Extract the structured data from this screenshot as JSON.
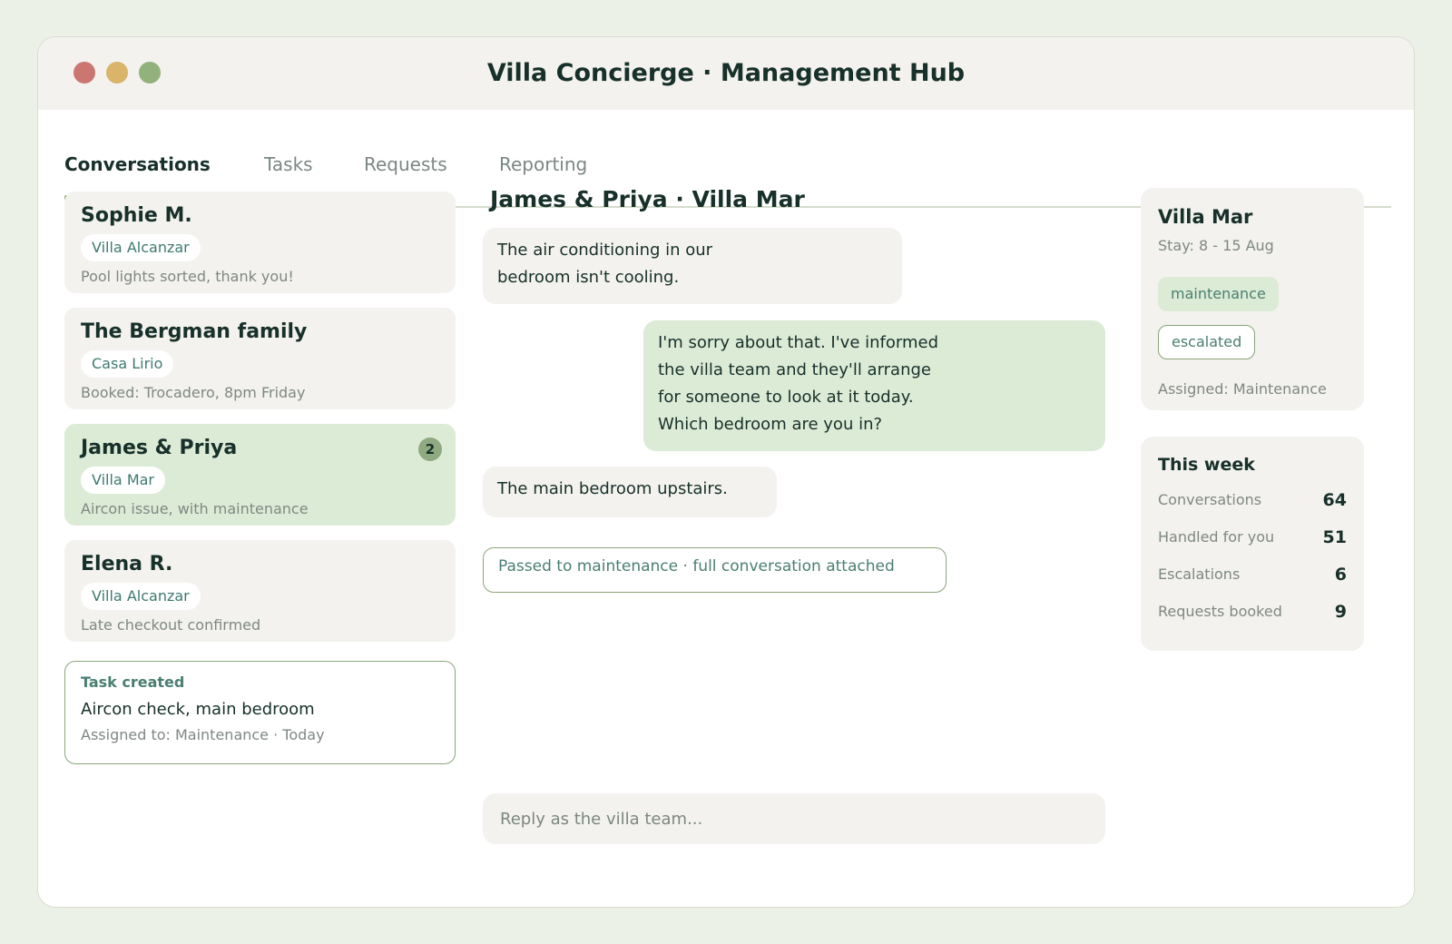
{
  "window": {
    "title": "Villa Concierge  ·  Management Hub"
  },
  "tabs": [
    {
      "label": "Conversations",
      "active": true
    },
    {
      "label": "Tasks"
    },
    {
      "label": "Requests"
    },
    {
      "label": "Reporting"
    }
  ],
  "conversations": [
    {
      "name": "Sophie M.",
      "villa": "Villa Alcanzar",
      "preview": "Pool lights sorted, thank you!"
    },
    {
      "name": "The Bergman family",
      "villa": "Casa Lirio",
      "preview": "Booked: Trocadero, 8pm Friday"
    },
    {
      "name": "James & Priya",
      "villa": "Villa Mar",
      "preview": "Aircon issue, with maintenance",
      "unread": "2",
      "active": true
    },
    {
      "name": "Elena R.",
      "villa": "Villa Alcanzar",
      "preview": "Late checkout confirmed"
    }
  ],
  "task": {
    "heading": "Task created",
    "title": "Aircon check, main bedroom",
    "meta": "Assigned to: Maintenance  ·  Today"
  },
  "chat": {
    "header": "James & Priya  ·  Villa Mar",
    "messages": [
      {
        "from": "guest",
        "lines": [
          "The air conditioning in our",
          "bedroom isn't cooling."
        ]
      },
      {
        "from": "team",
        "lines": [
          "I'm sorry about that. I've informed",
          "the villa team and they'll arrange",
          "for someone to look at it today.",
          "Which bedroom are you in?"
        ]
      },
      {
        "from": "guest",
        "lines": [
          "The main bedroom upstairs."
        ]
      }
    ],
    "handoff": "Passed to maintenance  ·  full conversation attached",
    "reply_placeholder": "Reply as the villa team..."
  },
  "villa_details": {
    "name": "Villa Mar",
    "stay": "Stay: 8 - 15 Aug",
    "tags": [
      "maintenance",
      "escalated"
    ],
    "assigned": "Assigned: Maintenance"
  },
  "stats": {
    "title": "This week",
    "rows": [
      {
        "label": "Conversations",
        "value": "64"
      },
      {
        "label": "Handled for you",
        "value": "51"
      },
      {
        "label": "Escalations",
        "value": "6"
      },
      {
        "label": "Requests booked",
        "value": "9"
      }
    ]
  },
  "colors": {
    "page_bg": "#ecf1e7",
    "accent_green": "#98b184",
    "active_card": "#dcebd6",
    "card_bg": "#f3f2ee",
    "text_dark": "#17302a",
    "text_teal": "#4a7f71",
    "close_dot": "#cc7671",
    "minimize_dot": "#d9b469",
    "maximize_dot": "#91b27d"
  }
}
